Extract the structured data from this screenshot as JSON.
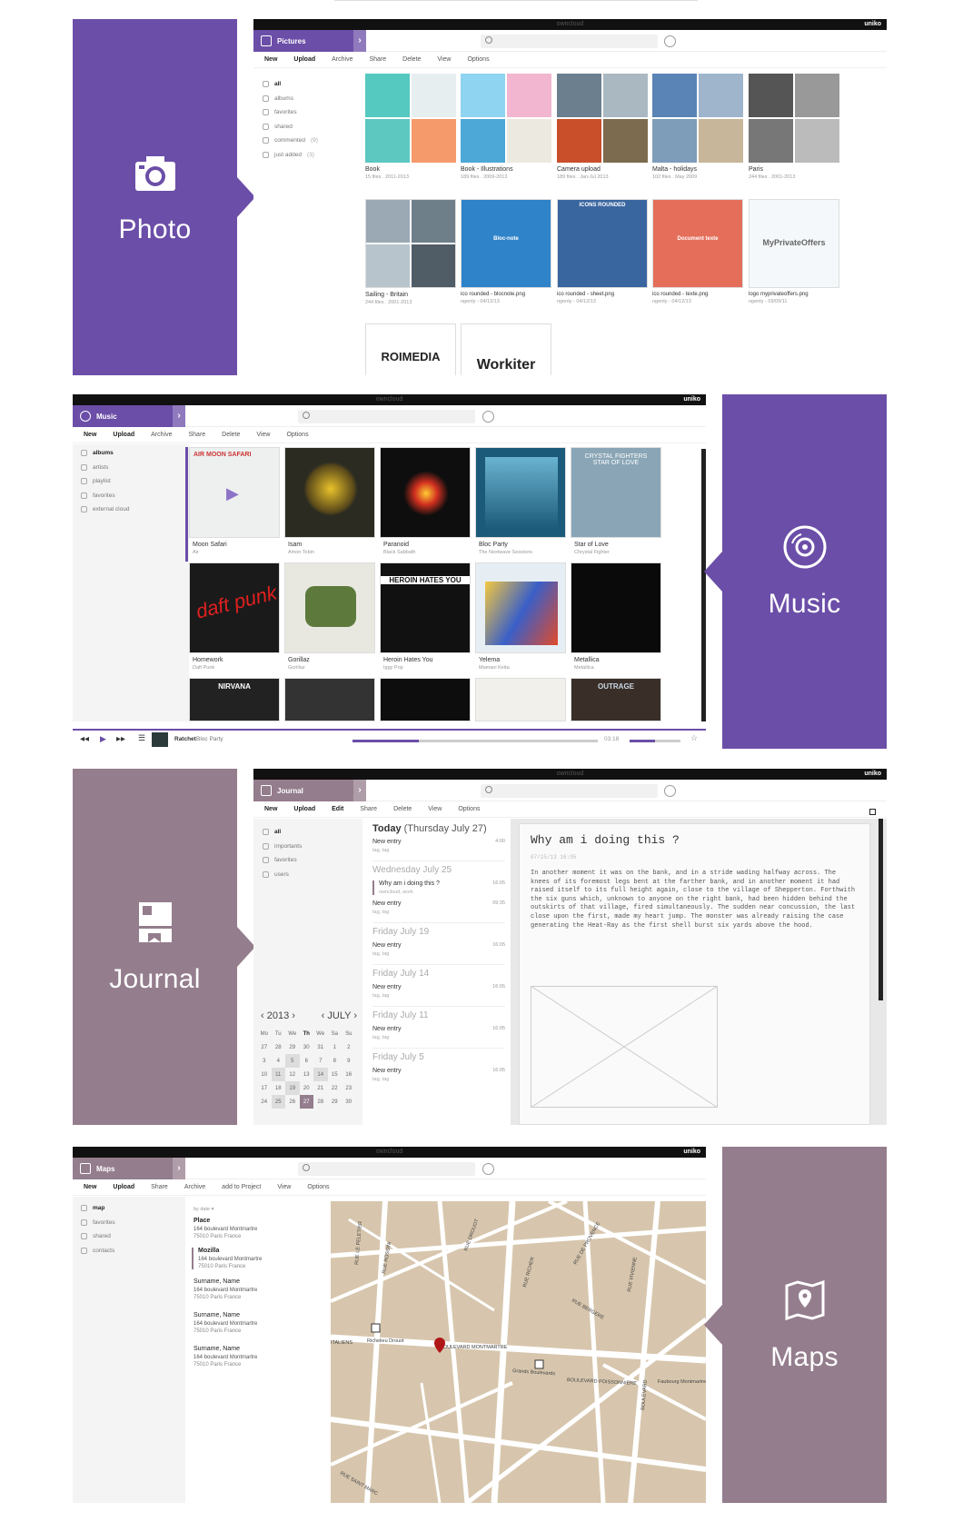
{
  "sections": {
    "photo": {
      "label": "Photo",
      "icon": "camera-icon",
      "color": "#6b4ea8"
    },
    "music": {
      "label": "Music",
      "icon": "music-disc-icon",
      "color": "#6b4ea8"
    },
    "journal": {
      "label": "Journal",
      "icon": "journal-icon",
      "color": "#947d8d"
    },
    "maps": {
      "label": "Maps",
      "icon": "map-icon",
      "color": "#947d8d"
    }
  },
  "common": {
    "brand": "owncloud",
    "user": "uniko"
  },
  "pictures": {
    "app": "Pictures",
    "toolbar": [
      "New",
      "Upload",
      "Archive",
      "Share",
      "Delete",
      "View",
      "Options"
    ],
    "sidebar": [
      {
        "label": "all"
      },
      {
        "label": "albums"
      },
      {
        "label": "favorites"
      },
      {
        "label": "shared"
      },
      {
        "label": "commented",
        "count": "(9)"
      },
      {
        "label": "just added",
        "count": "(3)"
      }
    ],
    "albums": [
      {
        "title": "Book",
        "sub": "15 files . 2011-2013"
      },
      {
        "title": "Book - Illustrations",
        "sub": "189 files . 2009-2013"
      },
      {
        "title": "Camera upload",
        "sub": "189 files . Jan-Jul 2013"
      },
      {
        "title": "Malta - holidays",
        "sub": "102 files . May 2009"
      },
      {
        "title": "Paris",
        "sub": "244 files . 2001-2013"
      },
      {
        "title": "Sailing - Britain",
        "sub": "244 files . 2001-2013"
      },
      {
        "title": "ico rounded - blocnote.png",
        "sub": "ngenty - 04/12/13"
      },
      {
        "title": "ico rounded - sheet.png",
        "sub": "ngenty - 04/12/13"
      },
      {
        "title": "ico rounded - texte.png",
        "sub": "ngenty - 04/12/13"
      },
      {
        "title": "logo myprivateoffers.png",
        "sub": "ngenty - 09/09/11"
      }
    ],
    "tiles": {
      "bloc": "Bloc-note",
      "icons": "ICONS ROUNDED",
      "doc": "Document texte",
      "mpo": "MyPrivateOffers",
      "roi": "ROIMEDIA",
      "work": "Workiter"
    }
  },
  "music": {
    "app": "Music",
    "toolbar": [
      "New",
      "Upload",
      "Archive",
      "Share",
      "Delete",
      "View",
      "Options"
    ],
    "sidebar": [
      {
        "label": "albums"
      },
      {
        "label": "artists"
      },
      {
        "label": "playlist"
      },
      {
        "label": "favorites"
      },
      {
        "label": "external cloud"
      }
    ],
    "albums": [
      {
        "title": "Moon Safari",
        "artist": "Air"
      },
      {
        "title": "Isam",
        "artist": "Amon Tobin"
      },
      {
        "title": "Paranoid",
        "artist": "Black Sabbath"
      },
      {
        "title": "Bloc Party",
        "artist": "The Nextwave Sessions"
      },
      {
        "title": "Star of Love",
        "artist": "Chrystal Fighter"
      },
      {
        "title": "Homework",
        "artist": "Daft Punk"
      },
      {
        "title": "Gorillaz",
        "artist": "Gorillaz"
      },
      {
        "title": "Heroin Hates You",
        "artist": "Iggy Pop"
      },
      {
        "title": "Yelema",
        "artist": "Mamani Keita"
      },
      {
        "title": "Metallica",
        "artist": "Metallica"
      }
    ],
    "cover_text": {
      "air": "AIR MOON SAFARI",
      "daft": "daft punk",
      "heroin": "HEROIN HATES YOU",
      "nirvana": "NIRVANA",
      "outrage": "OUTRAGE",
      "star": "CRYSTAL FIGHTERS STAR OF LOVE"
    },
    "player": {
      "track": "Ratchet",
      "artist": "Bloc Party",
      "time": "03:18",
      "progress": 0.27,
      "volume": 0.5
    }
  },
  "journal": {
    "app": "Journal",
    "toolbar": [
      "New",
      "Upload",
      "Edit",
      "Share",
      "Delete",
      "View",
      "Options"
    ],
    "sidebar": [
      {
        "label": "all"
      },
      {
        "label": "importants"
      },
      {
        "label": "favorites"
      },
      {
        "label": "users"
      }
    ],
    "today": "Today",
    "today_date": "(Thursday July 27)",
    "groups": [
      {
        "date": "",
        "entries": [
          {
            "title": "New entry",
            "tags": "tag, tag",
            "time": "4:00"
          }
        ]
      },
      {
        "date": "Wednesday July 25",
        "entries": [
          {
            "title": "Why am i doing this ?",
            "tags": "owncloud, work",
            "time": "16:05"
          },
          {
            "title": "New entry",
            "tags": "tag, tag",
            "time": "09:35"
          }
        ]
      },
      {
        "date": "Friday July 19",
        "entries": [
          {
            "title": "New entry",
            "tags": "tag, tag",
            "time": "16:05"
          }
        ]
      },
      {
        "date": "Friday July 14",
        "entries": [
          {
            "title": "New entry",
            "tags": "tag, tag",
            "time": "16:05"
          }
        ]
      },
      {
        "date": "Friday July 11",
        "entries": [
          {
            "title": "New entry",
            "tags": "tag, tag",
            "time": "16:05"
          }
        ]
      },
      {
        "date": "Friday July 5",
        "entries": [
          {
            "title": "New entry",
            "tags": "tag, tag",
            "time": "16:05"
          }
        ]
      }
    ],
    "calendar": {
      "year": "2013",
      "month": "JULY",
      "days": [
        "Mo",
        "Tu",
        "We",
        "Th",
        "We",
        "Sa",
        "Su"
      ],
      "weeks": [
        [
          "27",
          "28",
          "29",
          "30",
          "31",
          "1",
          "2"
        ],
        [
          "3",
          "4",
          "5",
          "6",
          "7",
          "8",
          "9"
        ],
        [
          "10",
          "11",
          "12",
          "13",
          "14",
          "15",
          "16"
        ],
        [
          "17",
          "18",
          "19",
          "20",
          "21",
          "22",
          "23"
        ],
        [
          "24",
          "25",
          "26",
          "27",
          "28",
          "29",
          "30"
        ]
      ]
    },
    "doc_title": "Why am i doing this ?",
    "doc_date": "07/25/13 16:05",
    "doc_body": "In another moment it was on the bank, and in a stride wading halfway across. The knees of its foremost legs bent at the farther bank, and in another moment it had raised itself to its full height again, close to the village of Shepperton. Forthwith the six guns which, unknown to anyone on the right bank, had been hidden behind the outskirts of that village, fired simultaneously. The sudden near concussion, the last close upon the first, made my heart jump. The monster was already raising the case generating the Heat-Ray as the first shell burst six yards above the hood."
  },
  "maps": {
    "app": "Maps",
    "toolbar": [
      "New",
      "Upload",
      "Share",
      "Archive",
      "add to Project",
      "View",
      "Options"
    ],
    "sidebar": [
      {
        "label": "map"
      },
      {
        "label": "favorites"
      },
      {
        "label": "shared"
      },
      {
        "label": "contacts"
      }
    ],
    "sort": "by date",
    "contacts": [
      {
        "name": "Place",
        "addr1": "164 boulevard Montmartre",
        "addr2": "75010 Paris France"
      },
      {
        "name": "Mozilla",
        "addr1": "164 boulevard Montmartre",
        "addr2": "75010 Paris France"
      },
      {
        "name": "Surname, Name",
        "addr1": "164 boulevard Montmartre",
        "addr2": "75010 Paris France"
      },
      {
        "name": "Surname, Name",
        "addr1": "164 boulevard Montmartre",
        "addr2": "75010 Paris France"
      },
      {
        "name": "Surname, Name",
        "addr1": "164 boulevard Montmartre",
        "addr2": "75010 Paris France"
      }
    ],
    "streets": [
      "BOULEVARD MONTMARTRE",
      "Richelieu Drouot",
      "Grands Boulevards",
      "BOULEVARD POISSONNIERE",
      "RUE ROSSINI",
      "RUE DROUOT",
      "RUE DE PROVENCE",
      "RUE LE PELETIER",
      "ITALIENS",
      "RUE RICHER",
      "RUE BERGERE",
      "RUE VIVIENNE",
      "BOULEVARD",
      "Faubourg Montmartre",
      "RUE SAINT MARC"
    ]
  }
}
